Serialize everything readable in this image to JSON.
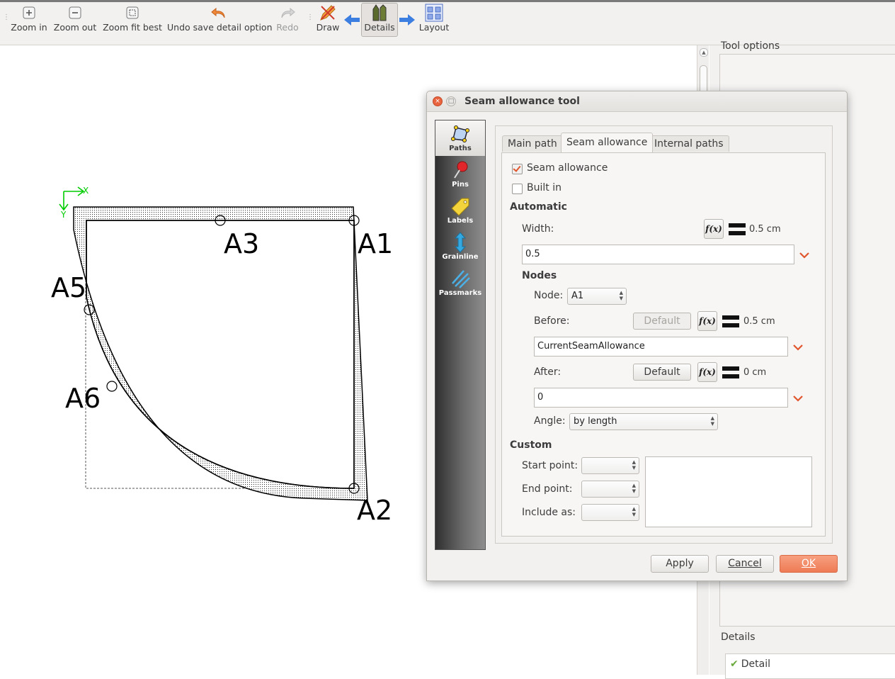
{
  "toolbar": {
    "items": [
      {
        "label": "Zoom in",
        "icon": "zoom-in-icon"
      },
      {
        "label": "Zoom out",
        "icon": "zoom-out-icon"
      },
      {
        "label": "Zoom fit best",
        "icon": "zoom-fit-icon"
      },
      {
        "label": "Undo save detail option",
        "icon": "undo-icon"
      },
      {
        "label": "Redo",
        "icon": "redo-icon",
        "disabled": true
      },
      {
        "label": "Draw",
        "icon": "draw-icon"
      },
      {
        "label": "Details",
        "icon": "details-icon",
        "active": true
      },
      {
        "label": "Layout",
        "icon": "layout-icon"
      }
    ]
  },
  "canvas": {
    "axis_x": "X",
    "axis_y": "Y",
    "points": [
      "A1",
      "A2",
      "A3",
      "A5",
      "A6"
    ]
  },
  "right_panel": {
    "tool_options_title": "Tool options",
    "details_title": "Details",
    "details_items": [
      "Detail"
    ]
  },
  "dialog": {
    "title": "Seam allowance tool",
    "sidebar": [
      "Paths",
      "Pins",
      "Labels",
      "Grainline",
      "Passmarks"
    ],
    "tabs": [
      "Main path",
      "Seam allowance",
      "Internal paths"
    ],
    "seam_allowance_label": "Seam allowance",
    "seam_allowance_checked": true,
    "built_in_label": "Built in",
    "built_in_checked": false,
    "automatic": {
      "heading": "Automatic",
      "width_label": "Width:",
      "width_value": "0.5 cm",
      "width_formula": "0.5"
    },
    "nodes": {
      "heading": "Nodes",
      "node_label": "Node:",
      "node_value": "A1",
      "before_label": "Before:",
      "before_default": "Default",
      "before_value": "0.5 cm",
      "before_formula": "CurrentSeamAllowance",
      "after_label": "After:",
      "after_default": "Default",
      "after_value": "0 cm",
      "after_formula": "0",
      "angle_label": "Angle:",
      "angle_value": "by length"
    },
    "custom": {
      "heading": "Custom",
      "start_label": "Start point:",
      "end_label": "End point:",
      "include_label": "Include as:"
    },
    "fx_label": "f(x)",
    "buttons": {
      "apply": "Apply",
      "cancel": "Cancel",
      "ok": "OK"
    },
    "colors": {
      "accent": "#ee7b55",
      "sidebar_dark": "#2f2f2f"
    }
  }
}
